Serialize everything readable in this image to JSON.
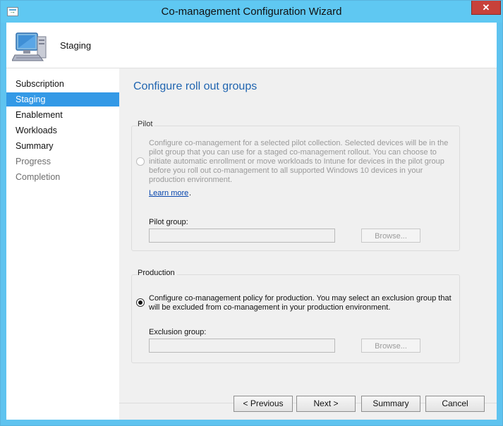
{
  "window": {
    "title": "Co-management Configuration Wizard",
    "close_label": "✕"
  },
  "header": {
    "title": "Staging"
  },
  "nav": {
    "items": [
      {
        "label": "Subscription"
      },
      {
        "label": "Staging"
      },
      {
        "label": "Enablement"
      },
      {
        "label": "Workloads"
      },
      {
        "label": "Summary"
      },
      {
        "label": "Progress"
      },
      {
        "label": "Completion"
      }
    ],
    "active_index": 1
  },
  "content": {
    "title": "Configure roll out groups",
    "pilot": {
      "group_title": "Pilot",
      "description": "Configure co-management for a selected pilot collection. Selected devices will be in the pilot group that you can use for a staged co-management rollout. You can choose to initiate automatic enrollment or move workloads to Intune for devices in the pilot group before you roll out co-management to all supported Windows 10 devices in your production environment.",
      "link": "Learn more",
      "link_suffix": ".",
      "field_label": "Pilot group:",
      "field_value": "",
      "browse": "Browse...",
      "selected": false
    },
    "production": {
      "group_title": "Production",
      "description": "Configure co-management policy for production. You may select an exclusion group that will be excluded from co-management in your production environment.",
      "field_label": "Exclusion group:",
      "field_value": "",
      "browse": "Browse...",
      "selected": true
    }
  },
  "footer": {
    "previous": "< Previous",
    "next": "Next >",
    "summary": "Summary",
    "cancel": "Cancel"
  },
  "colors": {
    "titlebar": "#5fc8f2",
    "accent": "#3399e6",
    "heading": "#1f64b0",
    "close": "#c7413a"
  }
}
